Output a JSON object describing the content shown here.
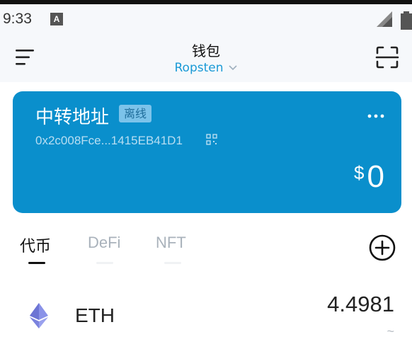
{
  "status_bar": {
    "time": "9:33",
    "notification_glyph": "A"
  },
  "header": {
    "title": "钱包",
    "network": "Ropsten"
  },
  "wallet_card": {
    "name": "中转地址",
    "badge": "离线",
    "address": "0x2c008Fce...1415EB41D1",
    "currency_symbol": "$",
    "balance": "0",
    "color": "#0a8fcc"
  },
  "tabs": [
    {
      "label": "代币",
      "active": true
    },
    {
      "label": "DeFi",
      "active": false
    },
    {
      "label": "NFT",
      "active": false
    }
  ],
  "tokens": [
    {
      "symbol": "ETH",
      "amount": "4.4981",
      "fiat": "~",
      "icon": "ethereum-icon"
    }
  ],
  "icons": {
    "menu": "hamburger-menu-icon",
    "scan": "scan-qr-icon",
    "more": "more-dots-icon",
    "qr": "qr-code-icon",
    "add": "add-circle-icon",
    "network_chevron": "chevron-down-icon"
  }
}
